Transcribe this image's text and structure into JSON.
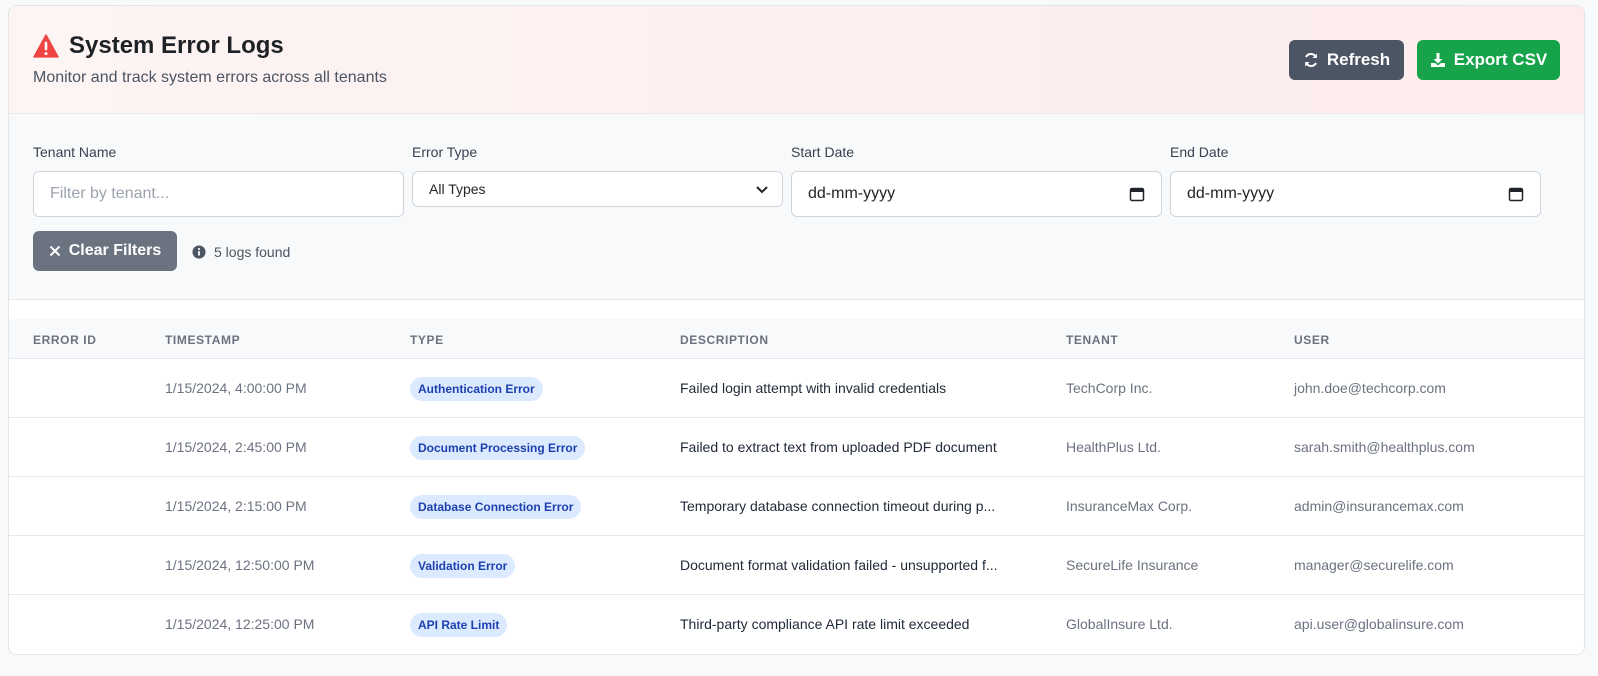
{
  "header": {
    "icon": "warning-triangle-icon",
    "title": "System Error Logs",
    "subtitle": "Monitor and track system errors across all tenants",
    "refresh_label": "Refresh",
    "export_label": "Export CSV"
  },
  "filters": {
    "tenant_label": "Tenant Name",
    "tenant_placeholder": "Filter by tenant...",
    "error_type_label": "Error Type",
    "error_type_value": "All Types",
    "start_date_label": "Start Date",
    "start_date_value": "dd-mm-yyyy",
    "end_date_label": "End Date",
    "end_date_value": "dd-mm-yyyy",
    "clear_label": "Clear Filters",
    "count_text": "5 logs found"
  },
  "table": {
    "columns": [
      "ERROR ID",
      "TIMESTAMP",
      "TYPE",
      "DESCRIPTION",
      "TENANT",
      "USER"
    ],
    "rows": [
      {
        "id": "",
        "timestamp": "1/15/2024, 4:00:00 PM",
        "type": "Authentication Error",
        "description": "Failed login attempt with invalid credentials",
        "tenant": "TechCorp Inc.",
        "user": "john.doe@techcorp.com"
      },
      {
        "id": "",
        "timestamp": "1/15/2024, 2:45:00 PM",
        "type": "Document Processing Error",
        "description": "Failed to extract text from uploaded PDF document",
        "tenant": "HealthPlus Ltd.",
        "user": "sarah.smith@healthplus.com"
      },
      {
        "id": "",
        "timestamp": "1/15/2024, 2:15:00 PM",
        "type": "Database Connection Error",
        "description": "Temporary database connection timeout during p...",
        "tenant": "InsuranceMax Corp.",
        "user": "admin@insurancemax.com"
      },
      {
        "id": "",
        "timestamp": "1/15/2024, 12:50:00 PM",
        "type": "Validation Error",
        "description": "Document format validation failed - unsupported f...",
        "tenant": "SecureLife Insurance",
        "user": "manager@securelife.com"
      },
      {
        "id": "",
        "timestamp": "1/15/2024, 12:25:00 PM",
        "type": "API Rate Limit",
        "description": "Third-party compliance API rate limit exceeded",
        "tenant": "GlobalInsure Ltd.",
        "user": "api.user@globalinsure.com"
      }
    ]
  },
  "colors": {
    "refresh_button": "#4b5563",
    "export_button": "#16a34a",
    "clear_button": "#6b7280",
    "warning_icon": "#ef4444",
    "badge_bg": "#dbeafe",
    "badge_text": "#1e40af"
  }
}
